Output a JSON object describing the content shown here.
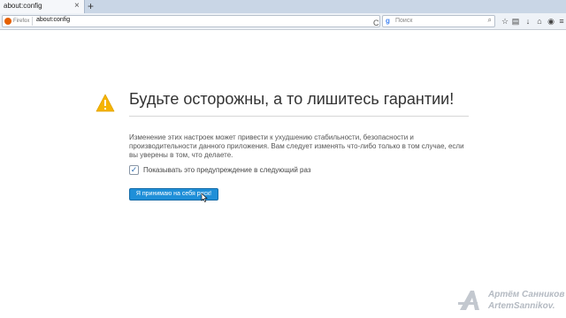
{
  "tab": {
    "title": "about:config",
    "close": "×"
  },
  "new_tab": "+",
  "url_bar": {
    "identity_label": "Firefox",
    "url": "about:config",
    "reload": "C"
  },
  "search": {
    "engine_glyph": "g",
    "placeholder": "Поиск",
    "button": "⌕"
  },
  "toolbar_icons": [
    "star-icon",
    "library-icon",
    "download-icon",
    "home-icon",
    "sync-icon",
    "menu-icon"
  ],
  "warning": {
    "heading": "Будьте осторожны, а то лишитесь гарантии!",
    "description": "Изменение этих настроек может привести к ухудшению стабильности, безопасности и производительности данного приложения. Вам следует изменять что-либо только в том случае, если вы уверены в том, что делаете.",
    "checkbox_label": "Показывать это предупреждение в следующий раз",
    "checkbox_checked": true,
    "accept_button": "Я принимаю на себя риск!"
  },
  "watermark": {
    "line1": "Артём Санников",
    "line2": "ArtemSannikov."
  },
  "colors": {
    "accent": "#1f8fd8",
    "warning_icon": "#f5b400"
  }
}
